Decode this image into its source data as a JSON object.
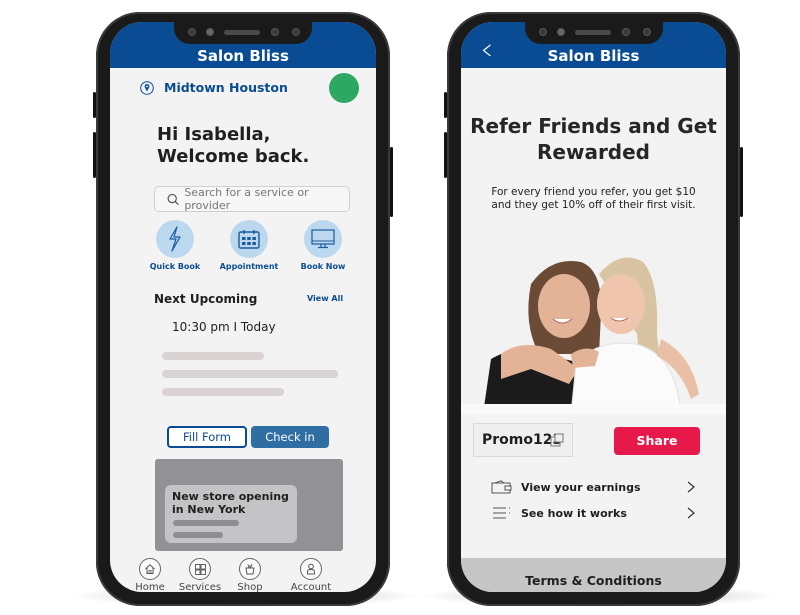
{
  "left_phone": {
    "app_title": "Salon Bliss",
    "location": "Midtown Houston",
    "greeting_line1": "Hi Isabella,",
    "greeting_line2": "Welcome back.",
    "search": {
      "placeholder": "Search for a service or provider",
      "icon": "search-icon"
    },
    "quick_actions": [
      {
        "label": "Quick Book",
        "icon": "lightning-icon"
      },
      {
        "label": "Appointment",
        "icon": "calendar-icon"
      },
      {
        "label": "Book Now",
        "icon": "monitor-icon"
      }
    ],
    "upcoming": {
      "title": "Next Upcoming",
      "view_all": "View All",
      "time": "10:30 pm I Today"
    },
    "buttons": {
      "fill_form": "Fill Form",
      "check_in": "Check in"
    },
    "banner": {
      "text_line1": "New store opening",
      "text_line2": "in New York"
    },
    "tabs": [
      {
        "label": "Home",
        "icon": "home-icon"
      },
      {
        "label": "Services",
        "icon": "grid-icon"
      },
      {
        "label": "Shop",
        "icon": "shopping-bag-icon"
      },
      {
        "label": "Account",
        "icon": "user-icon"
      }
    ],
    "colors": {
      "header": "#0a4c94",
      "avatar": "#2da862",
      "accent_button": "#2e6ea3"
    }
  },
  "right_phone": {
    "app_title": "Salon Bliss",
    "headline_line1": "Refer Friends and Get",
    "headline_line2": "Rewarded",
    "description": "For every friend you refer, you get $10 and they get 10% off of their first visit.",
    "photo_alt": "Two smiling women embracing",
    "promo_code": "Promo123",
    "share_label": "Share",
    "menu": [
      {
        "label": "View your earnings",
        "icon": "wallet-icon"
      },
      {
        "label": "See how it works",
        "icon": "list-icon"
      }
    ],
    "terms_label": "Terms & Conditions",
    "colors": {
      "header": "#0a4c94",
      "share": "#e6194a"
    }
  }
}
